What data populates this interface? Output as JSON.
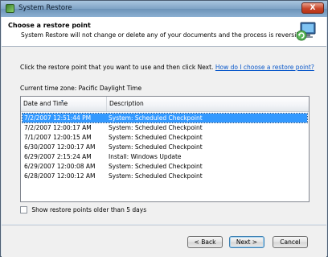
{
  "window": {
    "title": "System Restore",
    "close_glyph": "X"
  },
  "header": {
    "title": "Choose a restore point",
    "subtitle": "System Restore will not change or delete any of your documents and the process is reversible.",
    "icon": "system-restore-icon"
  },
  "instruction": {
    "text": "Click the restore point that you want to use and then click Next.",
    "link": "How do I choose a restore point?"
  },
  "timezone": "Current time zone: Pacific Daylight Time",
  "list": {
    "columns": [
      "Date and Time",
      "Description"
    ],
    "rows": [
      {
        "date": "7/2/2007 12:51:44 PM",
        "desc": "System: Scheduled Checkpoint",
        "selected": true
      },
      {
        "date": "7/2/2007 12:00:17 AM",
        "desc": "System: Scheduled Checkpoint"
      },
      {
        "date": "7/1/2007 12:00:15 AM",
        "desc": "System: Scheduled Checkpoint"
      },
      {
        "date": "6/30/2007 12:00:17 AM",
        "desc": "System: Scheduled Checkpoint"
      },
      {
        "date": "6/29/2007 2:15:24 AM",
        "desc": "Install: Windows Update"
      },
      {
        "date": "6/29/2007 12:00:08 AM",
        "desc": "System: Scheduled Checkpoint"
      },
      {
        "date": "6/28/2007 12:00:12 AM",
        "desc": "System: Scheduled Checkpoint"
      }
    ]
  },
  "checkbox": {
    "label": "Show restore points older than 5 days",
    "checked": false
  },
  "buttons": {
    "back": "< Back",
    "next": "Next >",
    "cancel": "Cancel"
  },
  "colors": {
    "selection": "#3399ff",
    "link": "#0a58ca"
  }
}
